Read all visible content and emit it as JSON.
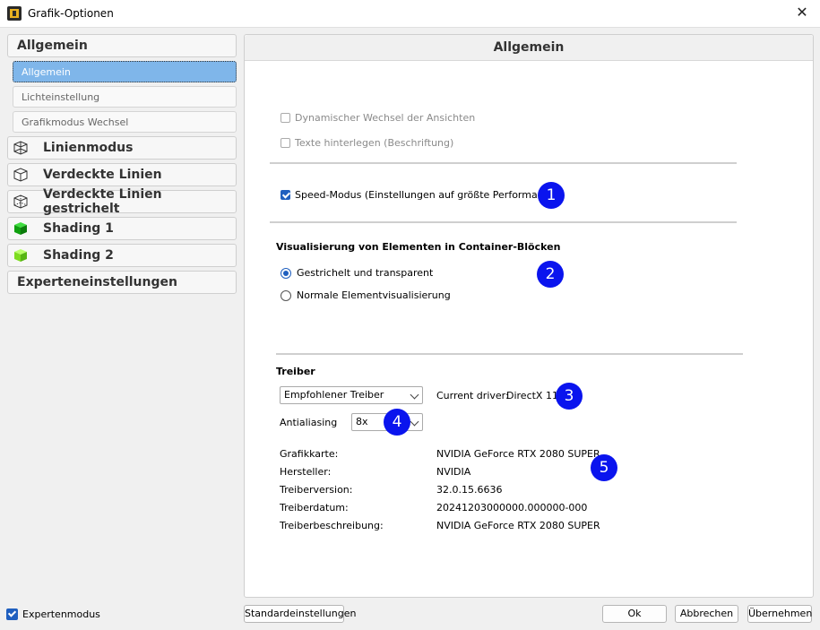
{
  "window": {
    "title": "Grafik-Optionen"
  },
  "sidebar": {
    "group_general": "Allgemein",
    "sub_items": [
      "Allgemein",
      "Lichteinstellung",
      "Grafikmodus Wechsel"
    ],
    "groups": [
      {
        "label": "Linienmodus",
        "icon": "wireframe-cube-icon"
      },
      {
        "label": "Verdeckte Linien",
        "icon": "hidden-line-cube-icon"
      },
      {
        "label": "Verdeckte Linien gestrichelt",
        "icon": "dashed-cube-icon"
      },
      {
        "label": "Shading 1",
        "icon": "green-cube-icon"
      },
      {
        "label": "Shading 2",
        "icon": "lightgreen-cube-icon"
      }
    ],
    "expert_settings": "Experteneinstellungen"
  },
  "panel": {
    "header": "Allgemein",
    "cb_dynamic": "Dynamischer Wechsel der Ansichten",
    "cb_text": "Texte hinterlegen (Beschriftung)",
    "cb_speed": "Speed-Modus (Einstellungen auf größte Performance)",
    "vis_heading": "Visualisierung von Elementen in Container-Blöcken",
    "radio_dashed": "Gestrichelt und transparent",
    "radio_normal": "Normale Elementvisualisierung",
    "driver_heading": "Treiber",
    "driver_select": "Empfohlener Treiber",
    "current_driver_label": "Current driver:",
    "current_driver_value": "DirectX 11",
    "antialiasing_label": "Antialiasing",
    "antialiasing_value": "8x",
    "info": [
      {
        "label": "Grafikkarte:",
        "value": "NVIDIA GeForce RTX 2080 SUPER"
      },
      {
        "label": "Hersteller:",
        "value": "NVIDIA"
      },
      {
        "label": "Treiberversion:",
        "value": "32.0.15.6636"
      },
      {
        "label": "Treiberdatum:",
        "value": "20241203000000.000000-000"
      },
      {
        "label": "Treiberbeschreibung:",
        "value": "NVIDIA GeForce RTX 2080 SUPER"
      }
    ],
    "markers": [
      "1",
      "2",
      "3",
      "4",
      "5"
    ]
  },
  "footer": {
    "expert_mode": "Expertenmodus",
    "defaults": "Standardeinstellungen",
    "ok": "Ok",
    "cancel": "Abbrechen",
    "apply": "Übernehmen"
  },
  "colors": {
    "accent": "#1f5fbf",
    "marker": "#0a14ee",
    "selection": "#7fb6ea"
  }
}
